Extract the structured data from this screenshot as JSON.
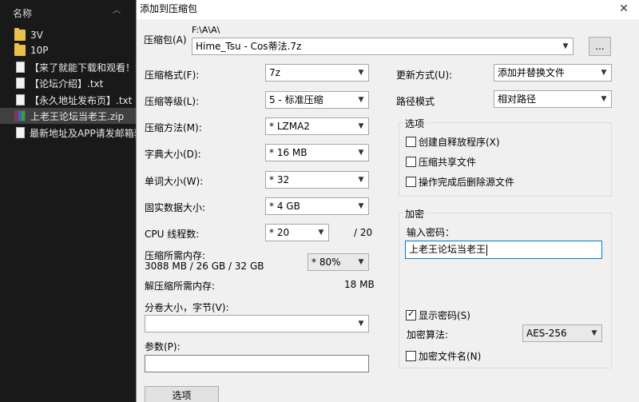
{
  "explorer": {
    "column_header": "名称",
    "items": [
      {
        "name": "3V",
        "type": "folder"
      },
      {
        "name": "10P",
        "type": "folder"
      },
      {
        "name": "【来了就能下载和观看！免",
        "type": "txt"
      },
      {
        "name": "【论坛介绍】.txt",
        "type": "txt"
      },
      {
        "name": "【永久地址发布页】.txt",
        "type": "txt"
      },
      {
        "name": "上老王论坛当老王.zip",
        "type": "zip",
        "selected": true
      },
      {
        "name": "最新地址及APP请发邮箱获",
        "type": "txt"
      }
    ]
  },
  "dialog": {
    "title": "添加到压缩包",
    "close_glyph": "✕",
    "archive": {
      "label": "压缩包(A)",
      "path": "F:\\A\\A\\",
      "value": "Hime_Tsu - Cos蒂法.7z",
      "browse_label": "..."
    },
    "left": {
      "format": {
        "label": "压缩格式(F):",
        "value": "7z"
      },
      "level": {
        "label": "压缩等级(L):",
        "value": "5 - 标准压缩"
      },
      "method": {
        "label": "压缩方法(M):",
        "value": "* LZMA2"
      },
      "dict": {
        "label": "字典大小(D):",
        "value": "* 16 MB"
      },
      "word": {
        "label": "单词大小(W):",
        "value": "* 32"
      },
      "solid": {
        "label": "固实数据大小:",
        "value": "* 4 GB"
      },
      "cpu": {
        "label": "CPU 线程数:",
        "value": "* 20",
        "total": "/ 20"
      },
      "mem": {
        "label": "压缩所需内存:",
        "detail": "3088 MB / 26 GB / 32 GB",
        "value": "* 80%"
      },
      "decomp": {
        "label": "解压缩所需内存:",
        "value": "18 MB"
      },
      "split": {
        "label": "分卷大小，字节(V):",
        "value": ""
      },
      "params": {
        "label": "参数(P):",
        "value": ""
      },
      "options_button": "选项"
    },
    "right": {
      "update": {
        "label": "更新方式(U):",
        "value": "添加并替换文件"
      },
      "pathmode": {
        "label": "路径模式",
        "value": "相对路径"
      },
      "options": {
        "title": "选项",
        "sfx": "创建自释放程序(X)",
        "shared": "压缩共享文件",
        "delete": "操作完成后删除源文件"
      },
      "encryption": {
        "title": "加密",
        "pw_label": "输入密码：",
        "pw_value": "上老王论坛当老王",
        "show_pw": "显示密码(S)",
        "algo_label": "加密算法:",
        "algo_value": "AES-256",
        "encrypt_names": "加密文件名(N)"
      }
    }
  }
}
